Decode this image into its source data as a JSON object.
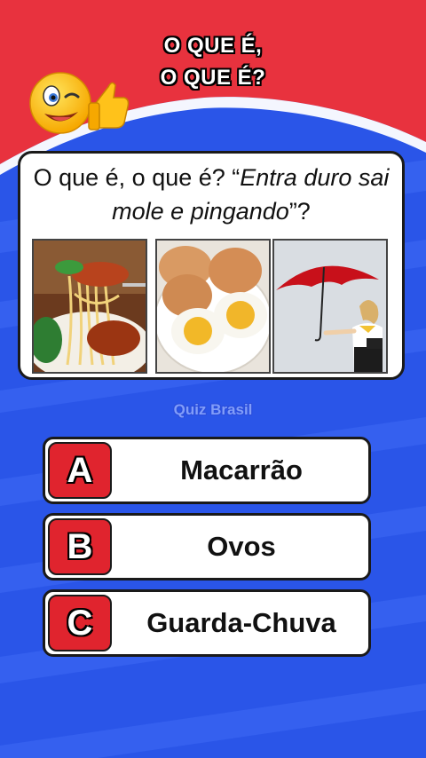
{
  "header": {
    "title_line1": "O QUE É,",
    "title_line2": "O QUE É?"
  },
  "question": {
    "text_plain": "O que é, o que é? “",
    "text_italic": "Entra duro sai mole e pingando",
    "text_end": "”?"
  },
  "images": [
    {
      "name": "spaghetti-image"
    },
    {
      "name": "eggs-image"
    },
    {
      "name": "umbrella-image"
    }
  ],
  "watermark": "Quiz Brasil",
  "options": [
    {
      "letter": "A",
      "label": "Macarrão"
    },
    {
      "letter": "B",
      "label": "Ovos"
    },
    {
      "letter": "C",
      "label": "Guarda-Chuva"
    }
  ],
  "colors": {
    "red": "#e0242e",
    "blue": "#2b55e6",
    "badge": "#e0242e"
  },
  "icons": [
    "winking-emoji-icon",
    "thumbs-up-icon"
  ]
}
